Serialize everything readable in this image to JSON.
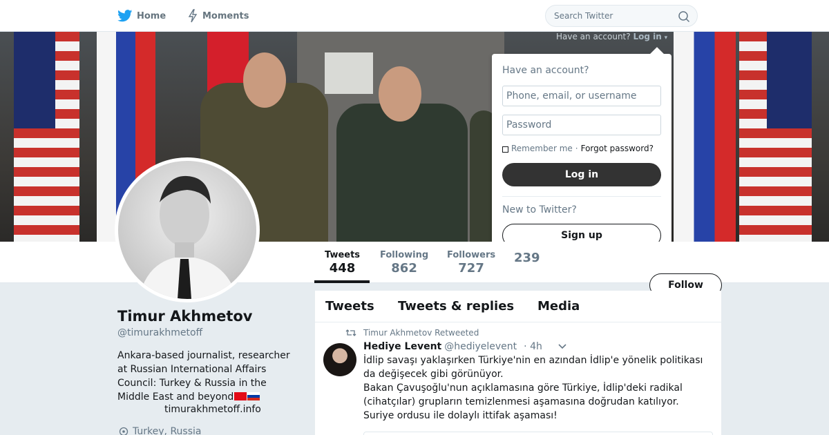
{
  "nav": {
    "home_label": "Home",
    "moments_label": "Moments",
    "search_placeholder": "Search Twitter",
    "have_account_hint": "Have an account?",
    "login_link": "Log in"
  },
  "login_panel": {
    "title": "Have an account?",
    "username_placeholder": "Phone, email, or username",
    "password_placeholder": "Password",
    "remember_me": "Remember me",
    "separator": "·",
    "forgot_password": "Forgot password?",
    "login_button": "Log in",
    "new_to_twitter": "New to Twitter?",
    "signup_button": "Sign up"
  },
  "stats": [
    {
      "label": "Tweets",
      "value": "448",
      "active": true
    },
    {
      "label": "Following",
      "value": "862"
    },
    {
      "label": "Followers",
      "value": "727"
    },
    {
      "label": "",
      "value": "239"
    }
  ],
  "follow_button": "Follow",
  "profile": {
    "name": "Timur Akhmetov",
    "handle": "@timurakhmetoff",
    "bio": "Ankara-based journalist, researcher at Russian International Affairs Council: Turkey & Russia in the Middle East and beyond",
    "website": "timurakhmetoff.info",
    "location": "Turkey, Russia"
  },
  "timeline": {
    "tabs": [
      "Tweets",
      "Tweets & replies",
      "Media"
    ],
    "retweet_context": "Timur Akhmetov Retweeted",
    "tweet": {
      "author_name": "Hediye Levent",
      "author_handle": "@hediyelevent",
      "time": "· 4h",
      "lines": [
        "İdlip savaşı yaklaşırken Türkiye'nin en azından İdlip'e yönelik politikası",
        "da değişecek gibi görünüyor.",
        "Bakan Çavuşoğlu'nun açıklamasına göre Türkiye, İdlip'deki radikal",
        "(cihatçılar) grupların temizlenmesi aşamasına doğrudan katılıyor.",
        "Suriye ordusu ile dolaylı ittifak aşaması!"
      ]
    }
  },
  "colors": {
    "brand_blue": "#1da1f2",
    "text_primary": "#14171a",
    "text_secondary": "#657786",
    "page_bg": "#e6ecf0"
  },
  "icons": {
    "home": "twitter-bird-icon",
    "moments": "lightning-icon",
    "search": "search-icon",
    "retweet": "retweet-icon",
    "location": "location-pin-icon",
    "caret": "chevron-down-icon"
  }
}
